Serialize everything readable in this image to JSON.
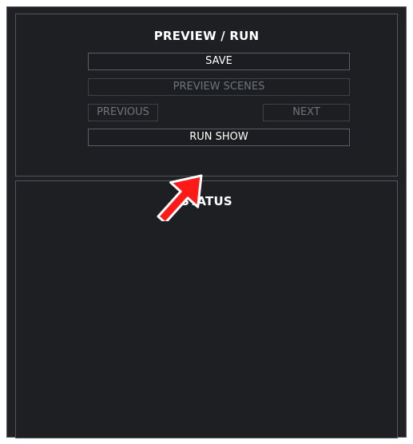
{
  "preview_panel": {
    "title": "PREVIEW / RUN",
    "save_label": "SAVE",
    "preview_scenes_label": "PREVIEW SCENES",
    "previous_label": "PREVIOUS",
    "next_label": "NEXT",
    "run_show_label": "RUN SHOW"
  },
  "status_panel": {
    "title": "STATUS"
  },
  "annotation": {
    "arrow_color": "#ff1a1a",
    "arrow_icon": "red-arrow-pointer-icon"
  },
  "colors": {
    "background": "#1f2124",
    "border": "#555a5f",
    "text": "#ffffff",
    "disabled_text": "#6f757b"
  }
}
